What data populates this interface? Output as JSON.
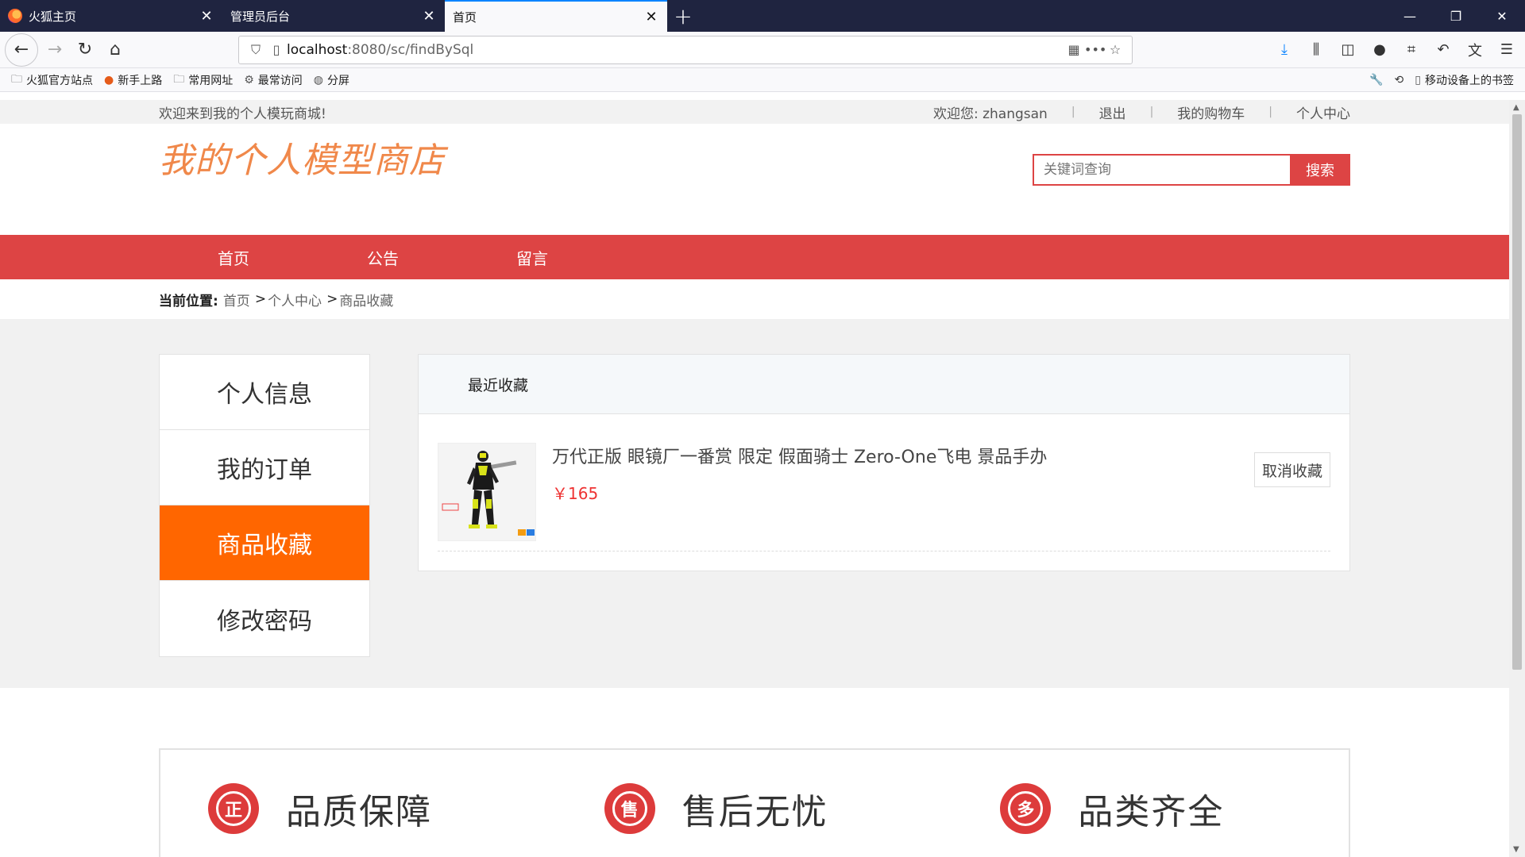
{
  "browser": {
    "tabs": [
      {
        "label": "火狐主页",
        "active": false
      },
      {
        "label": "管理员后台",
        "active": false
      },
      {
        "label": "首页",
        "active": true
      }
    ],
    "url": {
      "host": "localhost",
      "path": ":8080/sc/findBySql"
    },
    "bookmarks": [
      "火狐官方站点",
      "新手上路",
      "常用网址",
      "最常访问",
      "分屏"
    ],
    "mobile_bookmarks": "移动设备上的书签"
  },
  "topbar": {
    "welcome": "欢迎来到我的个人模玩商城!",
    "user_greeting": "欢迎您: zhangsan",
    "logout": "退出",
    "cart": "我的购物车",
    "profile": "个人中心"
  },
  "header": {
    "logo": "我的个人模型商店",
    "search_placeholder": "关键词查询",
    "search_button": "搜索"
  },
  "nav": [
    "首页",
    "公告",
    "留言"
  ],
  "breadcrumb": {
    "label": "当前位置:",
    "items": [
      "首页",
      "个人中心",
      "商品收藏"
    ]
  },
  "sidebar": [
    {
      "label": "个人信息",
      "active": false
    },
    {
      "label": "我的订单",
      "active": false
    },
    {
      "label": "商品收藏",
      "active": true
    },
    {
      "label": "修改密码",
      "active": false
    }
  ],
  "panel": {
    "title": "最近收藏",
    "items": [
      {
        "title": "万代正版 眼镜厂一番赏 限定 假面骑士 Zero-One飞电 景品手办",
        "price": "￥165",
        "action": "取消收藏"
      }
    ]
  },
  "features": [
    {
      "icon_text": "正",
      "label": "品质保障"
    },
    {
      "icon_text": "售",
      "label": "售后无忧"
    },
    {
      "icon_text": "多",
      "label": "品类齐全"
    }
  ],
  "colors": {
    "brand_red": "#dd4444",
    "active_orange": "#ff6600",
    "logo_orange": "#f0884a",
    "price_red": "#e33333"
  }
}
